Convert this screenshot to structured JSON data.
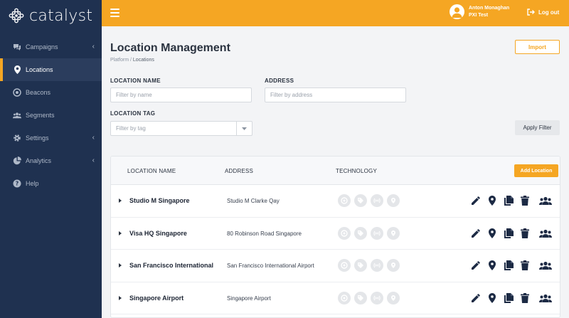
{
  "brand": {
    "name": "catalyst"
  },
  "sidebar": {
    "items": [
      {
        "label": "Campaigns",
        "icon": "chat-bubbles-icon",
        "has_submenu": true,
        "active": false
      },
      {
        "label": "Locations",
        "icon": "map-pin-icon",
        "has_submenu": false,
        "active": true
      },
      {
        "label": "Beacons",
        "icon": "beacon-icon",
        "has_submenu": false,
        "active": false
      },
      {
        "label": "Segments",
        "icon": "users-icon",
        "has_submenu": false,
        "active": false
      },
      {
        "label": "Settings",
        "icon": "gear-icon",
        "has_submenu": true,
        "active": false
      },
      {
        "label": "Analytics",
        "icon": "pie-chart-icon",
        "has_submenu": true,
        "active": false
      },
      {
        "label": "Help",
        "icon": "question-icon",
        "has_submenu": false,
        "active": false
      }
    ]
  },
  "topbar": {
    "user_name": "Anton Monaghan",
    "user_org": "PXI Test",
    "logout_label": "Log out"
  },
  "page": {
    "title": "Location Management",
    "breadcrumb_root": "Platform",
    "breadcrumb_sep": " / ",
    "breadcrumb_current": "Locations",
    "import_label": "Import"
  },
  "filters": {
    "name_label": "LOCATION NAME",
    "name_placeholder": "Filter by name",
    "address_label": "ADDRESS",
    "address_placeholder": "Filter by address",
    "tag_label": "LOCATION TAG",
    "tag_placeholder": "Filter by tag",
    "apply_label": "Apply Filter"
  },
  "table": {
    "columns": [
      "LOCATION NAME",
      "ADDRESS",
      "TECHNOLOGY"
    ],
    "add_label": "Add Location",
    "rows": [
      {
        "name": "Studio M Singapore",
        "address": "Studio M Clarke Qay"
      },
      {
        "name": "Visa HQ Singapore",
        "address": "80 Robinson Road Singapore"
      },
      {
        "name": "San Francisco International",
        "address": "San Francisco International Airport"
      },
      {
        "name": "Singapore Airport",
        "address": "Singapore Airport"
      }
    ]
  },
  "colors": {
    "accent": "#f5a623",
    "sidebar_bg": "#1f3150",
    "sidebar_active_bg": "#2b3d5d",
    "action_icon": "#1c2a44",
    "tech_disabled": "#e4e6e9"
  }
}
